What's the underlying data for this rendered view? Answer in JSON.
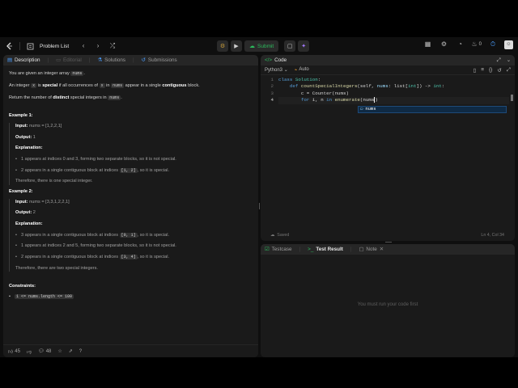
{
  "topbar": {
    "logo_icon": "leetcode-logo",
    "problem_list_label": "Problem List",
    "submit_label": "Submit",
    "streak_count": "0"
  },
  "description_panel": {
    "tabs": [
      {
        "label": "Description",
        "icon": "document-icon"
      },
      {
        "label": "Editorial",
        "icon": "book-icon"
      },
      {
        "label": "Solutions",
        "icon": "flask-icon"
      },
      {
        "label": "Submissions",
        "icon": "history-icon"
      }
    ],
    "intro_1": "You are given an integer array",
    "intro_1_code": "nums",
    "intro_2_a": "An integer",
    "intro_2_code_x": "x",
    "intro_2_b": "is",
    "intro_2_bold_special": "special",
    "intro_2_c": "if all occurrences of",
    "intro_2_code_x2": "x",
    "intro_2_d": "in",
    "intro_2_code_nums": "nums",
    "intro_2_e": "appear in a single",
    "intro_2_bold_contig": "contiguous",
    "intro_2_f": "block.",
    "intro_3_a": "Return the number of",
    "intro_3_bold": "distinct",
    "intro_3_b": "special integers in",
    "intro_3_code": "nums",
    "example1": {
      "title": "Example 1:",
      "input_label": "Input:",
      "input": "nums = [1,2,2,1]",
      "output_label": "Output:",
      "output": "1",
      "explanation_label": "Explanation:",
      "b1": "1 appears at indices 0 and 3, forming two separate blocks, so it is not special.",
      "b2_a": "2 appears in a single contiguous block at indices",
      "b2_code": "[1, 2]",
      "b2_b": ", so it is special.",
      "conclusion": "Therefore, there is one special integer."
    },
    "example2": {
      "title": "Example 2:",
      "input_label": "Input:",
      "input": "nums = [3,3,1,2,2,1]",
      "output_label": "Output:",
      "output": "2",
      "explanation_label": "Explanation:",
      "b1_a": "3 appears in a single contiguous block at indices",
      "b1_code": "[0, 1]",
      "b1_b": ", so it is special.",
      "b2": "1 appears at indices 2 and 5, forming two separate blocks, so it is not special.",
      "b3_a": "2 appears in a single contiguous block at indices",
      "b3_code": "[3, 4]",
      "b3_b": ", so it is special.",
      "conclusion": "Therefore, there are two special integers."
    },
    "constraints_title": "Constraints:",
    "constraint_1": "1 <= nums.length <= 100",
    "footer": {
      "likes": "45",
      "comments": "48"
    }
  },
  "code_panel": {
    "title": "Code",
    "language": "Python3",
    "mode": "Auto",
    "line_numbers": [
      "1",
      "2",
      "3",
      "4"
    ],
    "lines": {
      "l1_kw": "class",
      "l1_name": "Solution",
      "l1_colon": ":",
      "l2_kw": "def",
      "l2_fn": "countSpecialIntegers",
      "l2_rest_a": "(self, ",
      "l2_param": "nums",
      "l2_rest_b": ": list[",
      "l2_type": "int",
      "l2_rest_c": "]) -> ",
      "l2_ret": "int",
      "l2_colon": ":",
      "l3": "c = Counter(nums)",
      "l4_kw": "for",
      "l4_vars": " i, n ",
      "l4_in": "in",
      "l4_fn": " enumerate",
      "l4_rest": "(nums"
    },
    "suggestion": "nums",
    "status_saved": "Saved",
    "cursor_pos": "Ln 4, Col 34"
  },
  "test_panel": {
    "tabs": [
      {
        "label": "Testcase",
        "icon": "checkbox-icon"
      },
      {
        "label": "Test Result",
        "icon": "terminal-icon"
      },
      {
        "label": "Note",
        "icon": "note-icon"
      }
    ],
    "empty_message": "You must run your code first"
  }
}
